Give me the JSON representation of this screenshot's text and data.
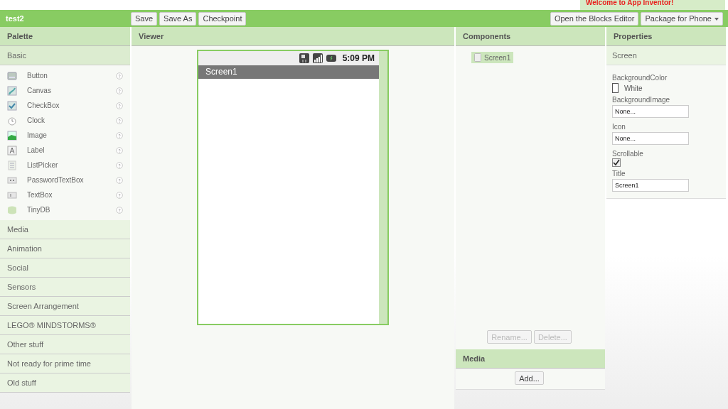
{
  "banner": {
    "message": "Welcome to App Inventor!"
  },
  "toolbar": {
    "project": "test2",
    "left_buttons": [
      "Save",
      "Save As",
      "Checkpoint"
    ],
    "right_buttons": [
      {
        "label": "Open the Blocks Editor",
        "dropdown": false
      },
      {
        "label": "Package for Phone",
        "dropdown": true
      }
    ]
  },
  "palette": {
    "title": "Palette",
    "categories": [
      {
        "label": "Basic",
        "expanded": true,
        "items": [
          {
            "label": "Button",
            "kind": "button"
          },
          {
            "label": "Canvas",
            "kind": "canvas"
          },
          {
            "label": "CheckBox",
            "kind": "checkbox"
          },
          {
            "label": "Clock",
            "kind": "clock"
          },
          {
            "label": "Image",
            "kind": "image"
          },
          {
            "label": "Label",
            "kind": "label"
          },
          {
            "label": "ListPicker",
            "kind": "list"
          },
          {
            "label": "PasswordTextBox",
            "kind": "password"
          },
          {
            "label": "TextBox",
            "kind": "textbox"
          },
          {
            "label": "TinyDB",
            "kind": "database"
          }
        ]
      },
      {
        "label": "Media",
        "expanded": false
      },
      {
        "label": "Animation",
        "expanded": false
      },
      {
        "label": "Social",
        "expanded": false
      },
      {
        "label": "Sensors",
        "expanded": false
      },
      {
        "label": "Screen Arrangement",
        "expanded": false
      },
      {
        "label": "LEGO® MINDSTORMS®",
        "expanded": false
      },
      {
        "label": "Other stuff",
        "expanded": false
      },
      {
        "label": "Not ready for prime time",
        "expanded": false
      },
      {
        "label": "Old stuff",
        "expanded": false
      }
    ]
  },
  "viewer": {
    "title": "Viewer",
    "phone": {
      "time": "5:09 PM",
      "screen_title": "Screen1"
    }
  },
  "components": {
    "title": "Components",
    "tree": [
      {
        "label": "Screen1",
        "selected": true
      }
    ],
    "buttons": [
      {
        "label": "Rename...",
        "disabled": true
      },
      {
        "label": "Delete...",
        "disabled": true
      }
    ]
  },
  "media": {
    "title": "Media",
    "button": "Add..."
  },
  "properties": {
    "title": "Properties",
    "component": "Screen",
    "items": [
      {
        "kind": "color",
        "label": "BackgroundColor",
        "value": "White",
        "color": "#ffffff"
      },
      {
        "kind": "field",
        "label": "BackgroundImage",
        "value": "None..."
      },
      {
        "kind": "field",
        "label": "Icon",
        "value": "None..."
      },
      {
        "kind": "checkbox",
        "label": "Scrollable",
        "checked": true
      },
      {
        "kind": "field",
        "label": "Title",
        "value": "Screen1"
      }
    ]
  }
}
